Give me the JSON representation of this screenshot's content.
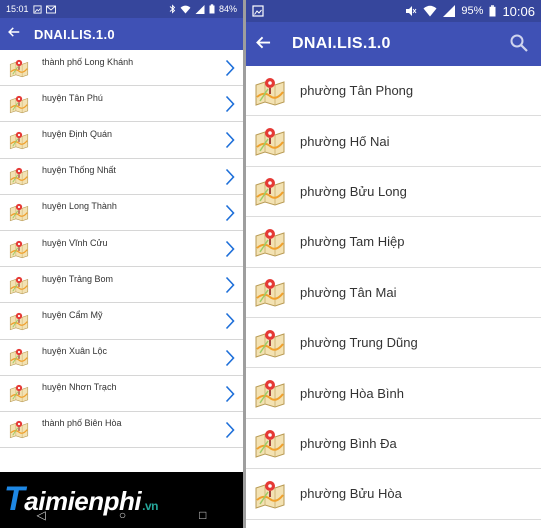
{
  "left_screen": {
    "status": {
      "time": "15:01",
      "battery": "84%"
    },
    "appbar": {
      "title": "DNAI.LIS.1.0"
    },
    "items": [
      {
        "label": "thành phố Long Khánh"
      },
      {
        "label": "huyện Tân Phú"
      },
      {
        "label": "huyện Định Quán"
      },
      {
        "label": "huyện Thống Nhất"
      },
      {
        "label": "huyện Long Thành"
      },
      {
        "label": "huyện Vĩnh Cửu"
      },
      {
        "label": "huyện Trảng Bom"
      },
      {
        "label": "huyện Cẩm Mỹ"
      },
      {
        "label": "huyện Xuân Lộc"
      },
      {
        "label": "huyện Nhơn Trạch"
      },
      {
        "label": "thành phố Biên Hòa"
      }
    ],
    "watermark": {
      "lead": "T",
      "main": "aimienphi",
      "suffix": ".vn"
    }
  },
  "right_screen": {
    "status": {
      "battery": "95%",
      "time": "10:06"
    },
    "appbar": {
      "title": "DNAI.LIS.1.0"
    },
    "items": [
      {
        "label": "phường Tân Phong"
      },
      {
        "label": "phường Hố Nai"
      },
      {
        "label": "phường Bửu Long"
      },
      {
        "label": "phường Tam Hiệp"
      },
      {
        "label": "phường Tân Mai"
      },
      {
        "label": "phường Trung Dũng"
      },
      {
        "label": "phường Hòa Bình"
      },
      {
        "label": "phường Bình Đa"
      },
      {
        "label": "phường Bửu Hòa"
      }
    ]
  },
  "colors": {
    "appbar": "#3f51b5",
    "statusbar": "#36469c",
    "chevron": "#1e6fd9",
    "pin": "#e53935"
  },
  "icons": {
    "back": "arrow-left-icon",
    "search": "search-icon",
    "item": "map-pin-icon",
    "chevron": "chevron-right-icon"
  }
}
